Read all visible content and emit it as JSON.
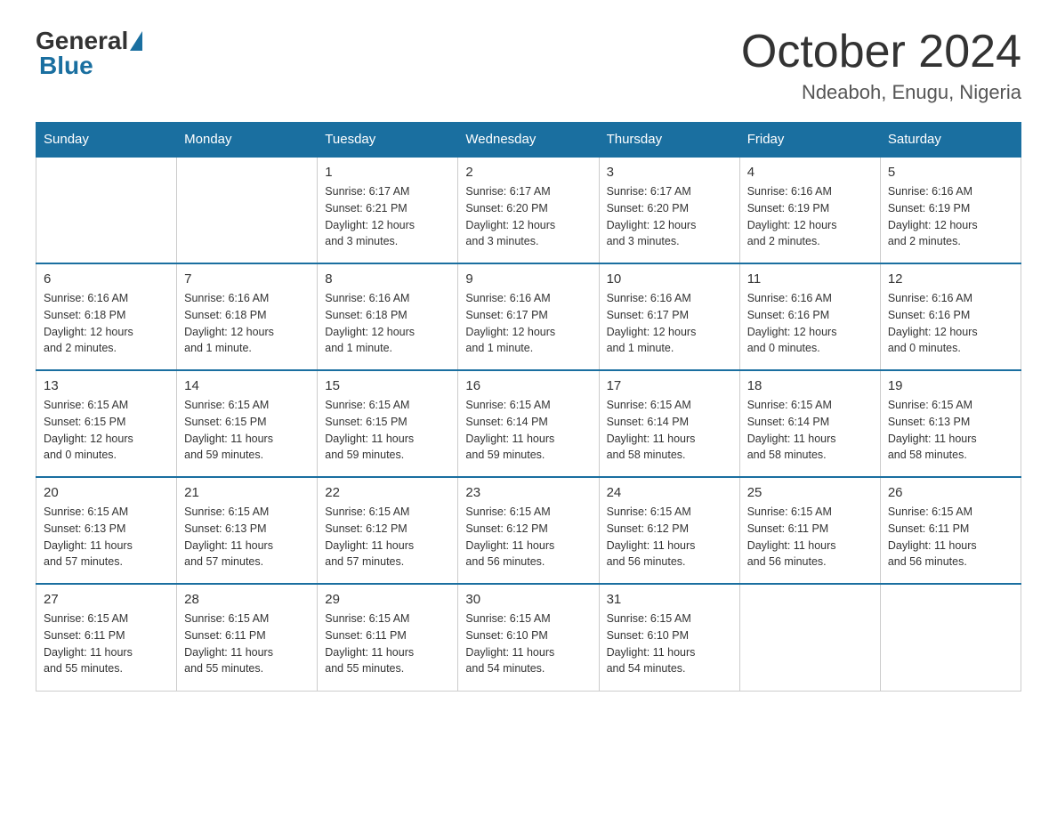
{
  "header": {
    "logo_general": "General",
    "logo_blue": "Blue",
    "title": "October 2024",
    "subtitle": "Ndeaboh, Enugu, Nigeria"
  },
  "weekdays": [
    "Sunday",
    "Monday",
    "Tuesday",
    "Wednesday",
    "Thursday",
    "Friday",
    "Saturday"
  ],
  "weeks": [
    [
      {
        "day": "",
        "info": ""
      },
      {
        "day": "",
        "info": ""
      },
      {
        "day": "1",
        "info": "Sunrise: 6:17 AM\nSunset: 6:21 PM\nDaylight: 12 hours\nand 3 minutes."
      },
      {
        "day": "2",
        "info": "Sunrise: 6:17 AM\nSunset: 6:20 PM\nDaylight: 12 hours\nand 3 minutes."
      },
      {
        "day": "3",
        "info": "Sunrise: 6:17 AM\nSunset: 6:20 PM\nDaylight: 12 hours\nand 3 minutes."
      },
      {
        "day": "4",
        "info": "Sunrise: 6:16 AM\nSunset: 6:19 PM\nDaylight: 12 hours\nand 2 minutes."
      },
      {
        "day": "5",
        "info": "Sunrise: 6:16 AM\nSunset: 6:19 PM\nDaylight: 12 hours\nand 2 minutes."
      }
    ],
    [
      {
        "day": "6",
        "info": "Sunrise: 6:16 AM\nSunset: 6:18 PM\nDaylight: 12 hours\nand 2 minutes."
      },
      {
        "day": "7",
        "info": "Sunrise: 6:16 AM\nSunset: 6:18 PM\nDaylight: 12 hours\nand 1 minute."
      },
      {
        "day": "8",
        "info": "Sunrise: 6:16 AM\nSunset: 6:18 PM\nDaylight: 12 hours\nand 1 minute."
      },
      {
        "day": "9",
        "info": "Sunrise: 6:16 AM\nSunset: 6:17 PM\nDaylight: 12 hours\nand 1 minute."
      },
      {
        "day": "10",
        "info": "Sunrise: 6:16 AM\nSunset: 6:17 PM\nDaylight: 12 hours\nand 1 minute."
      },
      {
        "day": "11",
        "info": "Sunrise: 6:16 AM\nSunset: 6:16 PM\nDaylight: 12 hours\nand 0 minutes."
      },
      {
        "day": "12",
        "info": "Sunrise: 6:16 AM\nSunset: 6:16 PM\nDaylight: 12 hours\nand 0 minutes."
      }
    ],
    [
      {
        "day": "13",
        "info": "Sunrise: 6:15 AM\nSunset: 6:15 PM\nDaylight: 12 hours\nand 0 minutes."
      },
      {
        "day": "14",
        "info": "Sunrise: 6:15 AM\nSunset: 6:15 PM\nDaylight: 11 hours\nand 59 minutes."
      },
      {
        "day": "15",
        "info": "Sunrise: 6:15 AM\nSunset: 6:15 PM\nDaylight: 11 hours\nand 59 minutes."
      },
      {
        "day": "16",
        "info": "Sunrise: 6:15 AM\nSunset: 6:14 PM\nDaylight: 11 hours\nand 59 minutes."
      },
      {
        "day": "17",
        "info": "Sunrise: 6:15 AM\nSunset: 6:14 PM\nDaylight: 11 hours\nand 58 minutes."
      },
      {
        "day": "18",
        "info": "Sunrise: 6:15 AM\nSunset: 6:14 PM\nDaylight: 11 hours\nand 58 minutes."
      },
      {
        "day": "19",
        "info": "Sunrise: 6:15 AM\nSunset: 6:13 PM\nDaylight: 11 hours\nand 58 minutes."
      }
    ],
    [
      {
        "day": "20",
        "info": "Sunrise: 6:15 AM\nSunset: 6:13 PM\nDaylight: 11 hours\nand 57 minutes."
      },
      {
        "day": "21",
        "info": "Sunrise: 6:15 AM\nSunset: 6:13 PM\nDaylight: 11 hours\nand 57 minutes."
      },
      {
        "day": "22",
        "info": "Sunrise: 6:15 AM\nSunset: 6:12 PM\nDaylight: 11 hours\nand 57 minutes."
      },
      {
        "day": "23",
        "info": "Sunrise: 6:15 AM\nSunset: 6:12 PM\nDaylight: 11 hours\nand 56 minutes."
      },
      {
        "day": "24",
        "info": "Sunrise: 6:15 AM\nSunset: 6:12 PM\nDaylight: 11 hours\nand 56 minutes."
      },
      {
        "day": "25",
        "info": "Sunrise: 6:15 AM\nSunset: 6:11 PM\nDaylight: 11 hours\nand 56 minutes."
      },
      {
        "day": "26",
        "info": "Sunrise: 6:15 AM\nSunset: 6:11 PM\nDaylight: 11 hours\nand 56 minutes."
      }
    ],
    [
      {
        "day": "27",
        "info": "Sunrise: 6:15 AM\nSunset: 6:11 PM\nDaylight: 11 hours\nand 55 minutes."
      },
      {
        "day": "28",
        "info": "Sunrise: 6:15 AM\nSunset: 6:11 PM\nDaylight: 11 hours\nand 55 minutes."
      },
      {
        "day": "29",
        "info": "Sunrise: 6:15 AM\nSunset: 6:11 PM\nDaylight: 11 hours\nand 55 minutes."
      },
      {
        "day": "30",
        "info": "Sunrise: 6:15 AM\nSunset: 6:10 PM\nDaylight: 11 hours\nand 54 minutes."
      },
      {
        "day": "31",
        "info": "Sunrise: 6:15 AM\nSunset: 6:10 PM\nDaylight: 11 hours\nand 54 minutes."
      },
      {
        "day": "",
        "info": ""
      },
      {
        "day": "",
        "info": ""
      }
    ]
  ]
}
